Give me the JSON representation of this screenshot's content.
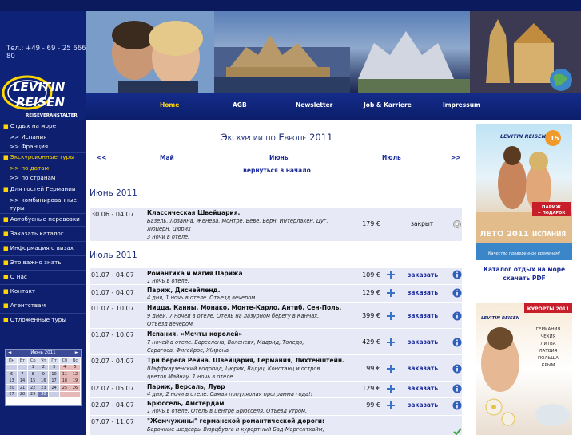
{
  "header": {
    "phone": "Тел.: +49 - 69 - 25 666 80",
    "logo_line1": "LEVITIN",
    "logo_line2": "REISEN",
    "logo_sub": "REISEVERANSTALTER"
  },
  "nav": [
    {
      "label": "Home",
      "active": true
    },
    {
      "label": "AGB"
    },
    {
      "label": "Newsletter"
    },
    {
      "label": "Job & Karriere"
    },
    {
      "label": "Impressum"
    }
  ],
  "sidebar": [
    {
      "label": "Отдых на море",
      "type": "main"
    },
    {
      "label": ">> Испания",
      "type": "sub"
    },
    {
      "label": ">> Франция",
      "type": "sub"
    },
    {
      "label": "Экскурсионные туры",
      "type": "main",
      "hl": true
    },
    {
      "label": ">> по датам",
      "type": "sub",
      "hl": true
    },
    {
      "label": ">> по странам",
      "type": "sub"
    },
    {
      "label": "Для гостей Германии",
      "type": "main"
    },
    {
      "label": ">> комбинированные туры",
      "type": "sub"
    },
    {
      "label": "Автобусные перевозки",
      "type": "main"
    },
    {
      "label": "Заказать каталог",
      "type": "main"
    },
    {
      "label": "Информация о визах",
      "type": "main"
    },
    {
      "label": "Это важно знать",
      "type": "main"
    },
    {
      "label": "О нас",
      "type": "main"
    },
    {
      "label": "Контакт",
      "type": "main"
    },
    {
      "label": "Агентствам",
      "type": "main"
    },
    {
      "label": "Отложенные туры",
      "type": "main"
    }
  ],
  "calendar": {
    "prev": "◄",
    "title": "Июнь 2011",
    "next": "►",
    "days": [
      "Пн",
      "Вт",
      "Ср",
      "Чт",
      "Пт",
      "Сб",
      "Вс"
    ],
    "weeks": [
      [
        "",
        "",
        "1",
        "2",
        "3",
        "4",
        "5"
      ],
      [
        "6",
        "7",
        "8",
        "9",
        "10",
        "11",
        "12"
      ],
      [
        "13",
        "14",
        "15",
        "16",
        "17",
        "18",
        "19"
      ],
      [
        "20",
        "21",
        "22",
        "23",
        "24",
        "25",
        "26"
      ],
      [
        "27",
        "28",
        "29",
        "30",
        "",
        "",
        ""
      ]
    ],
    "today": "30"
  },
  "main": {
    "title": "Экскурсии по Европе 2011",
    "prev": "<<",
    "m1": "Май",
    "m2": "Июнь",
    "m3": "Июль",
    "next": ">>",
    "back": "вернуться в начало",
    "june_label": "Июнь 2011",
    "july_label": "Июль 2011"
  },
  "june_tours": [
    {
      "dates": "30.06 - 04.07",
      "title": "Классическая Швейцария.",
      "desc": [
        "Базель, Лозанна, Женева, Монтре, Веве, Берн, Интерлакен, Цуг,",
        "Люцерн, Цюрих",
        "3 ночи в отеле."
      ],
      "price": "179 €",
      "action": "закрыт"
    }
  ],
  "july_tours": [
    {
      "dates": "01.07 - 04.07",
      "title": "Романтика и магия Парижа",
      "desc": [
        "1 ночь в отеле."
      ],
      "price": "109 €",
      "action": "заказать"
    },
    {
      "dates": "01.07 - 04.07",
      "title": "Париж, Диснейленд.",
      "desc": [
        "4 дня, 1 ночь в отеле. Отъезд вечером."
      ],
      "price": "129 €",
      "action": "заказать"
    },
    {
      "dates": "01.07 - 10.07",
      "title": "Ницца, Канны, Монако, Монте-Карло, Антиб, Сен-Поль.",
      "desc": [
        "9 дней, 7 ночей в отеле. Отель на лазурном берегу в Каннах.",
        "Отъезд вечером."
      ],
      "price": "399 €",
      "action": "заказать"
    },
    {
      "dates": "01.07 - 10.07",
      "title": "Испания. «Мечты королей»",
      "desc": [
        "7 ночей в отеле. Барселона, Валенсия, Мадрид, Толедо,",
        "Сарагоса, Фигейрос, Жирона"
      ],
      "price": "429 €",
      "action": "заказать"
    },
    {
      "dates": "02.07 - 04.07",
      "title": "Три берега Рейна. Швейцария, Германия, Лихтенштейн.",
      "desc": [
        "Шаффхаузенский водопад, Цюрих, Вадуц, Констанц и остров",
        "цветов Майнау. 1 ночь в отеле."
      ],
      "price": "99 €",
      "action": "заказать"
    },
    {
      "dates": "02.07 - 05.07",
      "title": "Париж, Версаль, Лувр",
      "desc": [
        "4 дня, 2 ночи в отеле. Самая популярная программа года!!"
      ],
      "price": "129 €",
      "action": "заказать"
    },
    {
      "dates": "02.07 - 04.07",
      "title": "Брюссель, Амстердам",
      "desc": [
        "1 ночь в отеле. Отель в центре Брюсселя. Отъезд утром."
      ],
      "price": "99 €",
      "action": "заказать"
    },
    {
      "dates": "07.07 - 11.07",
      "title": "\"Жемчужины\" германской романтической дороги:",
      "desc": [
        "Барочные шедевры Вюрцбурга и курортный Бад-Мергентхайм,"
      ],
      "price": "",
      "action": ""
    }
  ],
  "right": {
    "caption1": "Каталог отдых на море",
    "caption2": "скачать PDF",
    "cat1_brand": "LEVITIN REISEN",
    "cat1_badge": "15",
    "cat1_promo1": "ПАРИЖ",
    "cat1_promo2": "+ ПОДАРОК",
    "cat1_year": "ЛЕТО 2011",
    "cat1_country": "ИСПАНИЯ",
    "cat1_slogan": "Качество проверенное временем!",
    "cat2_brand": "LEVITIN REISEN",
    "cat2_title": "КУРОРТЫ 2011",
    "cat2_list": [
      "ГЕРМАНИЯ",
      "ЧЕХИЯ",
      "ЛИТВА",
      "ЛАТВИЯ",
      "ПОЛЬША",
      "КРЫМ"
    ]
  },
  "colors": {
    "navy": "#0d1f6e",
    "accent": "#ffd600",
    "link": "#1a2b9a",
    "row": "#e7e9f7"
  }
}
